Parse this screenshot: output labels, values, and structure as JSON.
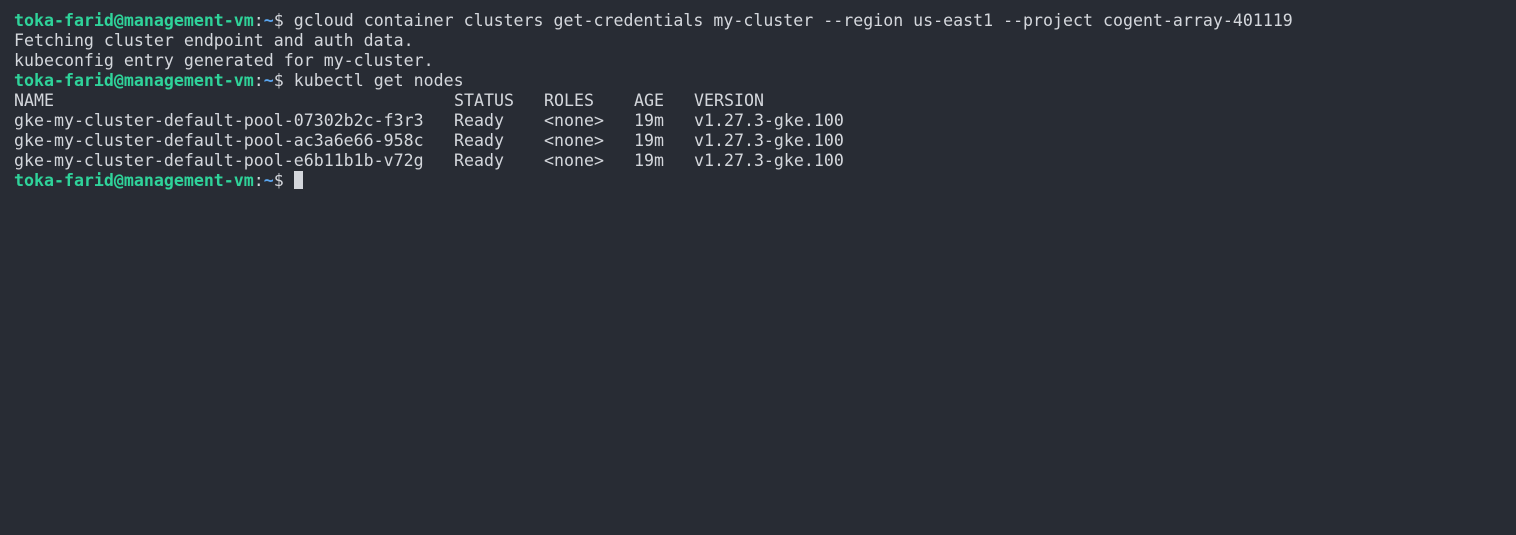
{
  "prompt": {
    "user_host": "toka-farid@management-vm",
    "colon": ":",
    "path": "~",
    "symbol": "$"
  },
  "commands": [
    {
      "text": " gcloud container clusters get-credentials my-cluster --region us-east1 --project cogent-array-401119",
      "output": [
        "Fetching cluster endpoint and auth data.",
        "kubeconfig entry generated for my-cluster."
      ]
    },
    {
      "text": " kubectl get nodes"
    }
  ],
  "nodes_table": {
    "headers": [
      "NAME",
      "STATUS",
      "ROLES",
      "AGE",
      "VERSION"
    ],
    "rows": [
      [
        "gke-my-cluster-default-pool-07302b2c-f3r3",
        "Ready",
        "<none>",
        "19m",
        "v1.27.3-gke.100"
      ],
      [
        "gke-my-cluster-default-pool-ac3a6e66-958c",
        "Ready",
        "<none>",
        "19m",
        "v1.27.3-gke.100"
      ],
      [
        "gke-my-cluster-default-pool-e6b11b1b-v72g",
        "Ready",
        "<none>",
        "19m",
        "v1.27.3-gke.100"
      ]
    ]
  },
  "colors": {
    "background": "#282c34",
    "prompt_user": "#2fd39a",
    "prompt_path": "#5aa6f0",
    "text": "#d4d7dc"
  }
}
